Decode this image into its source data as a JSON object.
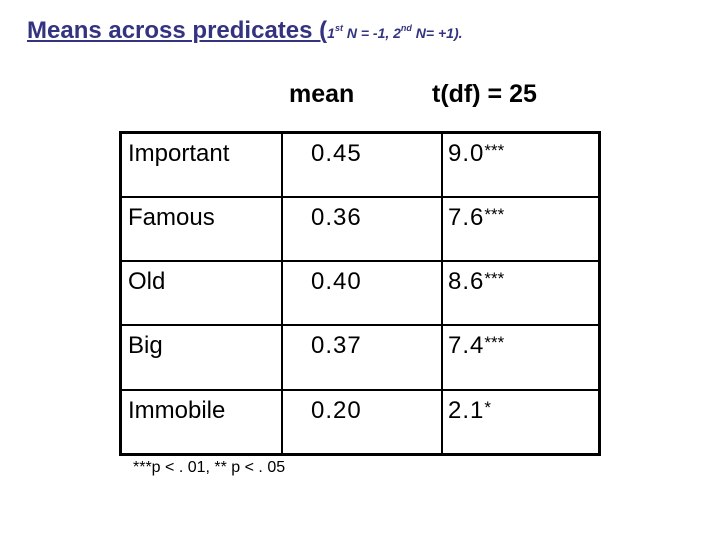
{
  "title": {
    "main": "Means across predicates (",
    "sub_part1": "1",
    "sub_sup1": "st",
    "sub_part2": " N = -1, 2",
    "sub_sup2": "nd",
    "sub_part3": "  N= +1).",
    "color": "#333380"
  },
  "columns": {
    "mean": "mean",
    "t": "t(df) = 25"
  },
  "rows": [
    {
      "predicate": "Important",
      "mean": "0.45",
      "t": "9.0",
      "sig": "***"
    },
    {
      "predicate": "Famous",
      "mean": "0.36",
      "t": "7.6",
      "sig": "***"
    },
    {
      "predicate": "Old",
      "mean": "0.40",
      "t": "8.6",
      "sig": "***"
    },
    {
      "predicate": "Big",
      "mean": "0.37",
      "t": "7.4",
      "sig": "***"
    },
    {
      "predicate": "Immobile",
      "mean": "0.20",
      "t": "2.1",
      "sig": "*"
    }
  ],
  "footnote": "***p < . 01, ** p  < . 05"
}
